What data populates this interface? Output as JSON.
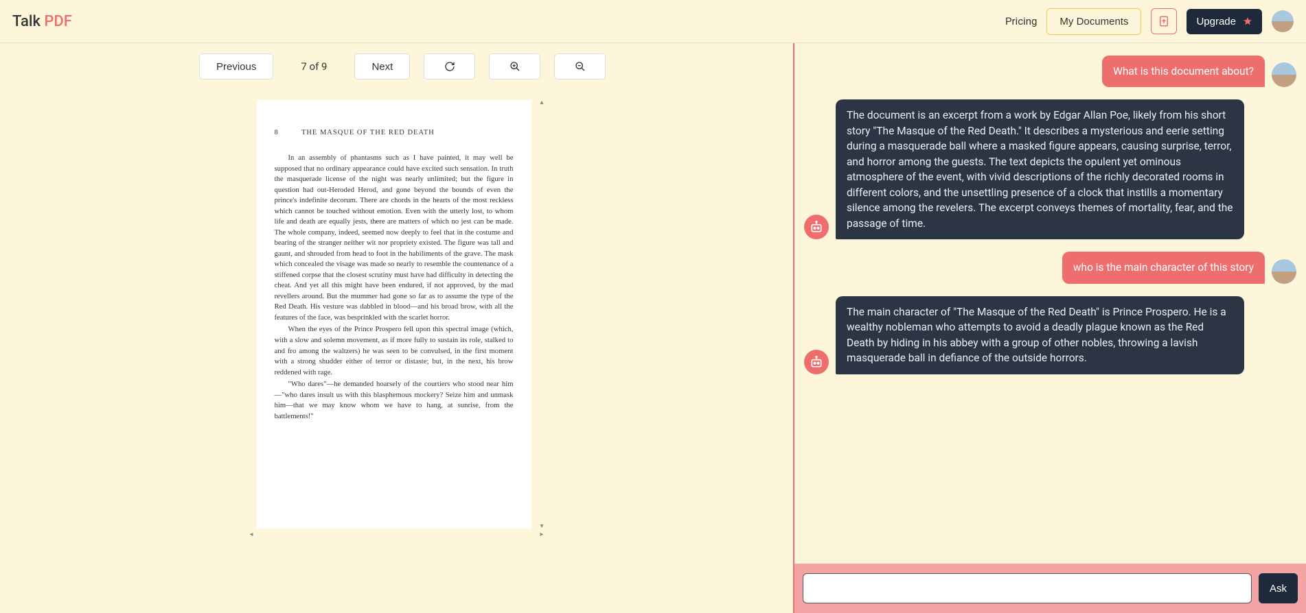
{
  "header": {
    "logo_part1": "Talk ",
    "logo_part2": "PDF",
    "pricing": "Pricing",
    "my_documents": "My Documents",
    "upgrade": "Upgrade"
  },
  "toolbar": {
    "previous": "Previous",
    "page_indicator": "7 of 9",
    "next": "Next"
  },
  "document": {
    "page_number": "8",
    "title": "THE MASQUE OF THE RED DEATH",
    "paragraphs": [
      "In an assembly of phantasms such as I have painted, it may well be supposed that no ordinary appearance could have excited such sensation. In truth the masquerade license of the night was nearly unlimited; but the figure in question had out-Heroded Herod, and gone beyond the bounds of even the prince's indefinite decorum. There are chords in the hearts of the most reckless which cannot be touched without emotion. Even with the utterly lost, to whom life and death are equally jests, there are matters of which no jest can be made. The whole company, indeed, seemed now deeply to feel that in the costume and bearing of the stranger neither wit nor propriety existed. The figure was tall and gaunt, and shrouded from head to foot in the habiliments of the grave. The mask which concealed the visage was made so nearly to resemble the countenance of a stiffened corpse that the closest scrutiny must have had difficulty in detecting the cheat. And yet all this might have been endured, if not approved, by the mad revellers around. But the mummer had gone so far as to assume the type of the Red Death. His vesture was dabbled in blood—and his broad brow, with all the features of the face, was besprinkled with the scarlet horror.",
      "When the eyes of the Prince Prospero fell upon this spectral image (which, with a slow and solemn movement, as if more fully to sustain its role, stalked to and fro among the waltzers) he was seen to be convulsed, in the first moment with a strong shudder either of terror or distaste; but, in the next, his brow reddened with rage.",
      "\"Who dares\"—he demanded hoarsely of the courtiers who stood near him—\"who dares insult us with this blasphemous mockery? Seize him and unmask him—that we may know whom we have to hang, at sunrise, from the battlements!\""
    ]
  },
  "chat": {
    "messages": [
      {
        "role": "user",
        "text": "What is this document about?"
      },
      {
        "role": "bot",
        "text": "The document is an excerpt from a work by Edgar Allan Poe, likely from his short story \"The Masque of the Red Death.\" It describes a mysterious and eerie setting during a masquerade ball where a masked figure appears, causing surprise, terror, and horror among the guests. The text depicts the opulent yet ominous atmosphere of the event, with vivid descriptions of the richly decorated rooms in different colors, and the unsettling presence of a clock that instills a momentary silence among the revelers. The excerpt conveys themes of mortality, fear, and the passage of time."
      },
      {
        "role": "user",
        "text": "who is the main character of this story"
      },
      {
        "role": "bot",
        "text": "The main character of \"The Masque of the Red Death\" is Prince Prospero. He is a wealthy nobleman who attempts to avoid a deadly plague known as the Red Death by hiding in his abbey with a group of other nobles, throwing a lavish masquerade ball in defiance of the outside horrors."
      }
    ],
    "ask_label": "Ask",
    "input_placeholder": ""
  }
}
